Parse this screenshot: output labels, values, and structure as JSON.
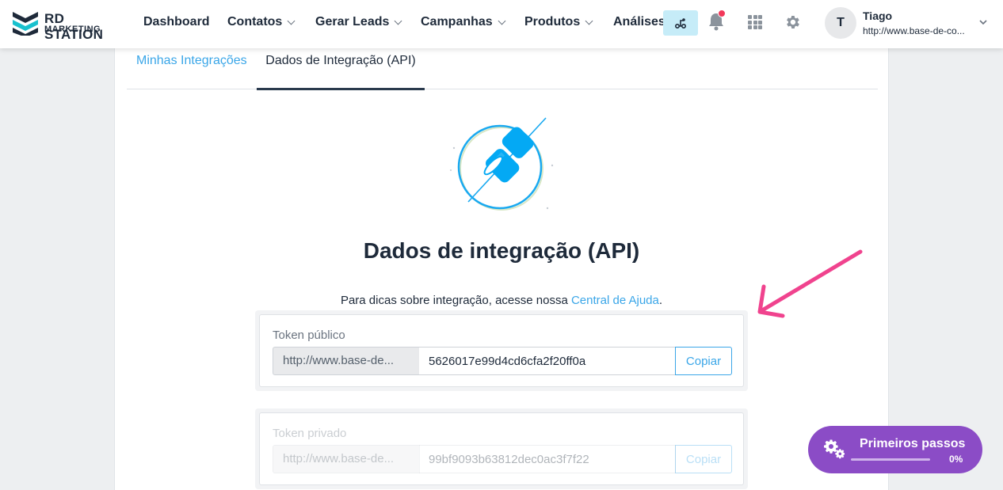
{
  "brand": {
    "line1": "RD STATION",
    "line2": "MARKETING"
  },
  "nav": [
    {
      "label": "Dashboard",
      "dropdown": false
    },
    {
      "label": "Contatos",
      "dropdown": true
    },
    {
      "label": "Gerar Leads",
      "dropdown": true
    },
    {
      "label": "Campanhas",
      "dropdown": true
    },
    {
      "label": "Produtos",
      "dropdown": true
    },
    {
      "label": "Análises",
      "dropdown": false
    }
  ],
  "user": {
    "initial": "T",
    "name": "Tiago",
    "url": "http://www.base-de-co..."
  },
  "tabs": {
    "first": "Minhas Integrações",
    "second": "Dados de Integração (API)",
    "active": "second"
  },
  "page": {
    "title": "Dados de integração (API)",
    "hint_prefix": "Para dicas sobre integração, acesse nossa ",
    "hint_link": "Central de Ajuda",
    "hint_suffix": "."
  },
  "tokens": {
    "public": {
      "label": "Token público",
      "prefix": "http://www.base-de...",
      "value": "5626017e99d4cd6cfa2f20ff0a",
      "button": "Copiar"
    },
    "private": {
      "label": "Token privado",
      "prefix": "http://www.base-de...",
      "value": "99bf9093b63812dec0ac3f7f22",
      "button": "Copiar"
    }
  },
  "onboarding": {
    "label": "Primeiros passos",
    "progress": "0%"
  },
  "colors": {
    "accent": "#3aa6e8",
    "purple": "#8b4cc6",
    "arrow": "#f0438e",
    "notification": "#f2385a"
  }
}
